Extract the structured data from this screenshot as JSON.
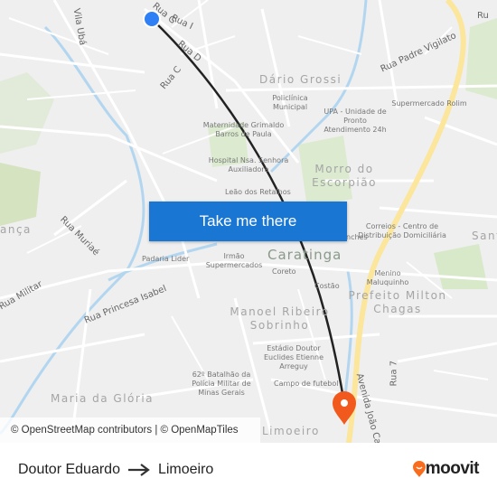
{
  "map": {
    "streets": [
      "Rua G",
      "Rua I",
      "Rua D",
      "Rua C",
      "Rua Padre Vigilato",
      "Rua Muriaé",
      "Rua Militar",
      "Rua Princesa Isabel",
      "Avenida João Ca",
      "Rua 7",
      "Vila Ubá",
      "Ru"
    ],
    "neighborhoods": [
      "Dário Grossi",
      "Morro do Escorpião",
      "Prefeito Milton Chagas",
      "Manoel Ribeiro Sobrinho",
      "Maria da Glória",
      "Sant",
      "ança",
      "Limoeiro"
    ],
    "city": "Caratinga",
    "pois": [
      "Policlínica Municipal",
      "UPA - Unidade de Pronto Atendimento 24h",
      "Supermercado Rolim",
      "Maternidade Grimaldo Barros de Paula",
      "Hospital Nsa. Senhora Auxiliadora",
      "Leão dos Retalhos",
      "Correios - Centro de Distribuição Domiciliária",
      "Menino Maluquinho",
      "Padaria Lider",
      "Irmão Supermercados",
      "Coreto",
      "Costão",
      "Estádio Doutor Euclides Etienne Arreguy",
      "62º Batalhão da Polícia Militar de Minas Gerais",
      "Campo de futebol",
      "nches"
    ],
    "colors": {
      "origin": "#2f7ff5",
      "destination": "#f25a1d",
      "route": "#222222",
      "highway": "#fbe69c",
      "water": "#a9d3f2",
      "park": "#d7e9c8"
    }
  },
  "cta": {
    "label": "Take me there"
  },
  "attribution": {
    "osm": "© OpenStreetMap contributors",
    "sep": " | ",
    "omt": "© OpenMapTiles"
  },
  "footer": {
    "origin": "Doutor Eduardo",
    "destination": "Limoeiro",
    "arrow_icon": "arrow-right-icon",
    "brand": "moovit",
    "brand_color": "#f96b1d"
  }
}
